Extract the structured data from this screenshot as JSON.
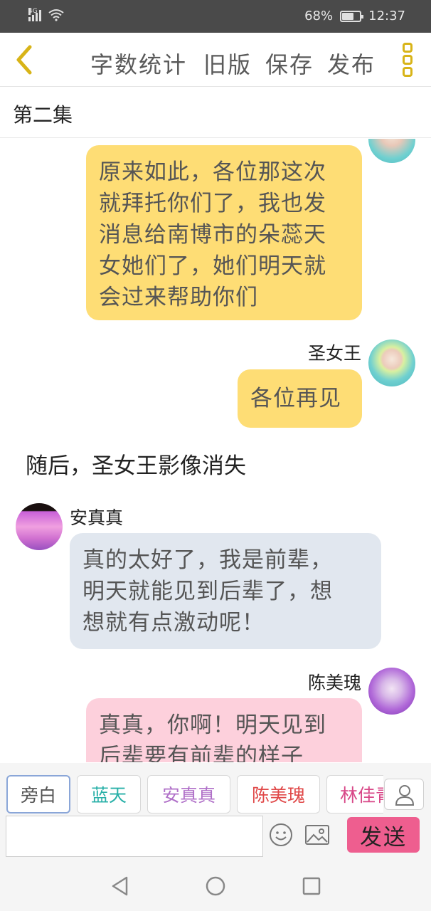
{
  "status": {
    "network": "4G",
    "battery_text": "68%",
    "battery_level": 0.68,
    "time": "12:37"
  },
  "toolbar": {
    "word_count": "字数统计",
    "old_version": "旧版",
    "save": "保存",
    "publish": "发布"
  },
  "episode": {
    "title": "第二集"
  },
  "messages": [
    {
      "text_lines": [
        "原来如此，各位那这次",
        "就拜托你们了，我也发",
        "消息给南博市的朵蕊天",
        "女她们了，她们明天就",
        "会过来帮助你们"
      ]
    },
    {
      "speaker": "圣女王",
      "text": "各位再见"
    },
    {
      "narration": "随后，圣女王影像消失"
    },
    {
      "speaker": "安真真",
      "text_lines": [
        "真的太好了，我是前辈，",
        "明天就能见到后辈了，想",
        "想就有点激动呢！"
      ]
    },
    {
      "speaker": "陈美瑰",
      "text_lines": [
        "真真，你啊！明天见到",
        "后辈要有前辈的样子"
      ]
    }
  ],
  "characters": [
    {
      "label": "旁白",
      "color": "#555555"
    },
    {
      "label": "蓝天",
      "color": "#28b0a8"
    },
    {
      "label": "安真真",
      "color": "#b070c8"
    },
    {
      "label": "陈美瑰",
      "color": "#e04848"
    },
    {
      "label": "林佳青",
      "color": "#d84888"
    }
  ],
  "input": {
    "value": "",
    "placeholder": ""
  },
  "send": {
    "label": "发送"
  },
  "icons": {
    "back": "chevron-left-icon",
    "more": "more-vertical-icon",
    "person": "person-icon",
    "emoji": "smiley-icon",
    "image": "image-icon"
  },
  "colors": {
    "accent_yellow": "#d8b418",
    "bubble_yellow": "#fedd75",
    "bubble_blue": "#e1e7ef",
    "bubble_pink": "#fdd0dc",
    "send_pink": "#ee5e8f"
  }
}
